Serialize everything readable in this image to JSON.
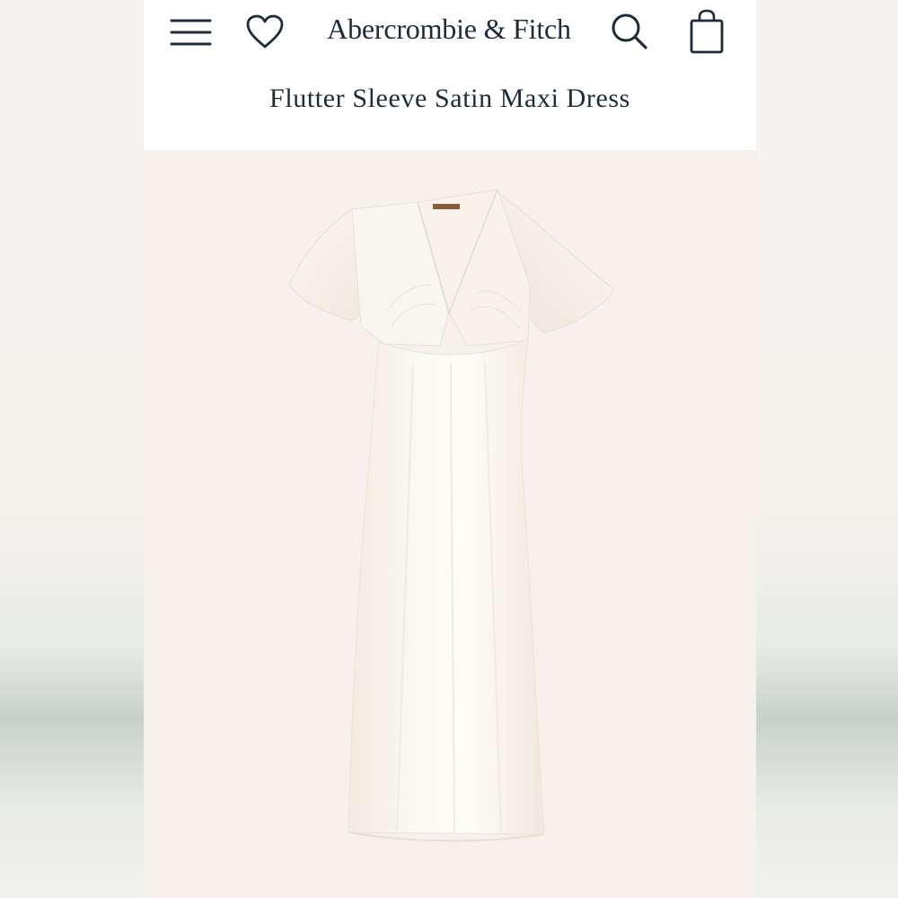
{
  "header": {
    "brand": "Abercrombie & Fitch",
    "menu_icon": "hamburger-menu-icon",
    "wishlist_icon": "heart-icon",
    "search_icon": "search-icon",
    "bag_icon": "shopping-bag-icon"
  },
  "product": {
    "title": "Flutter Sleeve Satin Maxi Dress",
    "image_subject": "ivory satin maxi dress with flutter sleeves"
  },
  "colors": {
    "text": "#1d2b3a",
    "header_bg": "#ffffff",
    "image_bg": "#f7f1ee",
    "dress": "#f9f6ee"
  }
}
